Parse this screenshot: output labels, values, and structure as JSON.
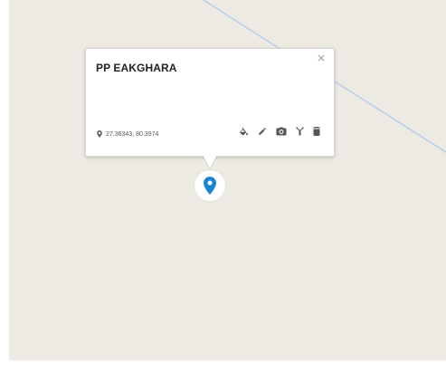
{
  "popup": {
    "title": "PP EAKGHARA",
    "close_symbol": "×",
    "coordinates": "27.36343, 80.3974",
    "tools": [
      {
        "name": "fill-color-icon"
      },
      {
        "name": "edit-pencil-icon"
      },
      {
        "name": "camera-icon"
      },
      {
        "name": "directions-fork-icon"
      },
      {
        "name": "delete-trash-icon"
      }
    ]
  },
  "colors": {
    "map_background": "#edeae3",
    "road": "#a9c9ec",
    "marker": "#1a86d3",
    "icon": "#555555"
  }
}
